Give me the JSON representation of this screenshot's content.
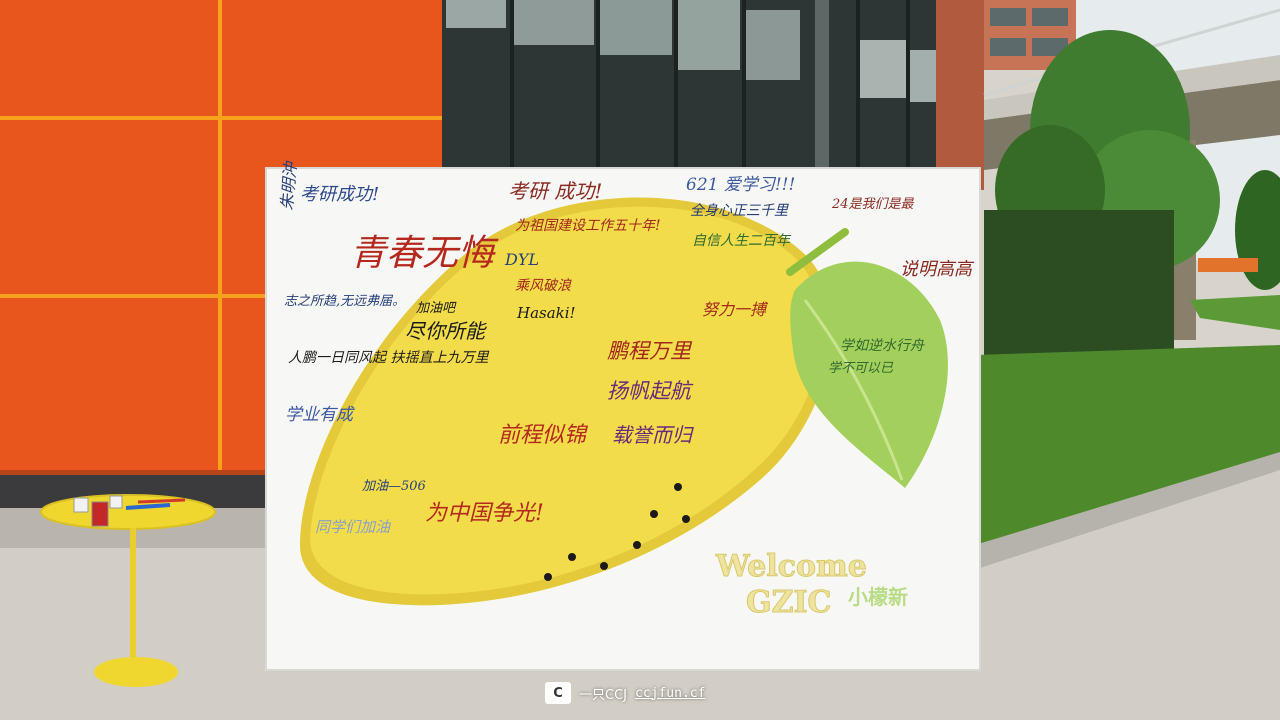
{
  "board": {
    "welcome_line1": "Welcome",
    "welcome_line2": "GZIC",
    "welcome_cn": "小檬新"
  },
  "handwriting": [
    "朱明沖",
    "考研成功!",
    "考研 成功!",
    "621 爱学习!!!",
    "为祖国建设工作五十年!",
    "全身心正三千里",
    "自信人生二百年",
    "24是我们是最",
    "青春无悔",
    "DYL",
    "乘风破浪",
    "说明高高",
    "志之所趋,无远弗届。",
    "加油吧",
    "尽你所能",
    "Hasaki!",
    "扬帆起航",
    "努力一搏",
    "人鹏一日同风起 扶摇直上九万里",
    "学业有成",
    "鹏程万里",
    "为中国争光!",
    "学如逆水行舟",
    "前程似锦",
    "载誉而归",
    "学不可以已",
    "加油—506",
    "同学们加油"
  ],
  "watermark": {
    "logo": "C",
    "author": "一只CCJ",
    "url": "ccjfun.cf"
  },
  "colors": {
    "wall_orange": "#e8561e",
    "lemon_yellow": "#f2dc4a",
    "leaf_green": "#a3cf5c",
    "board_white": "#f7f8f6",
    "grass": "#4e8a2c"
  }
}
